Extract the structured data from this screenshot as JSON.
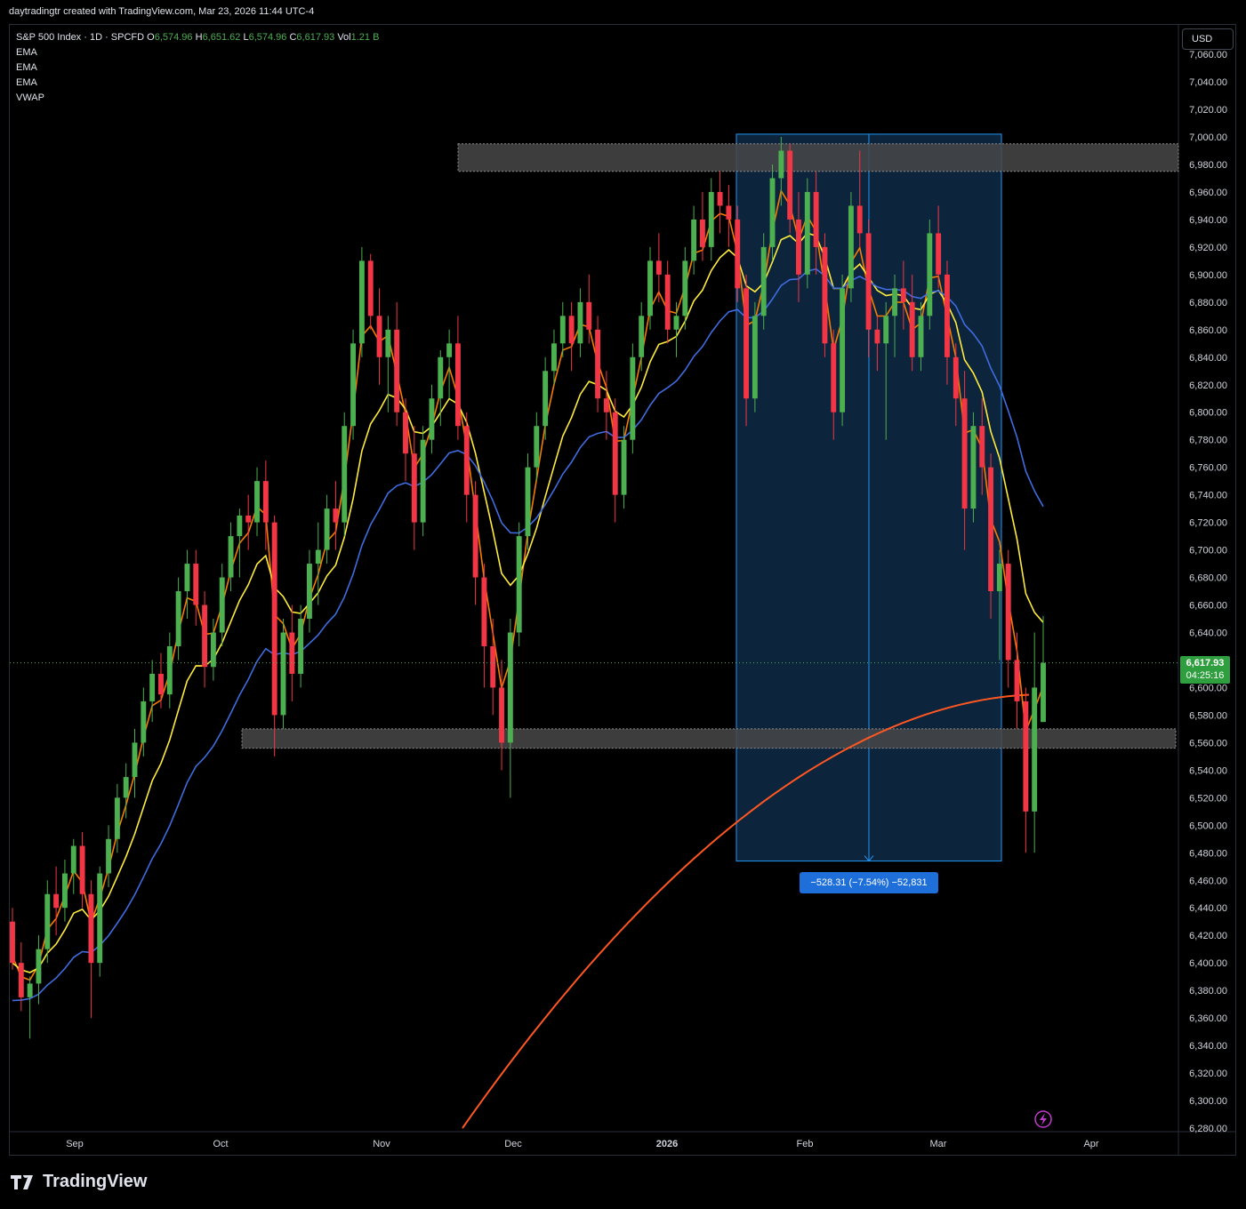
{
  "attribution": "daytradingtr created with TradingView.com, Mar 23, 2026 11:44 UTC-4",
  "legend": {
    "symbol": "S&P 500 Index · 1D · SPCFD",
    "o_label": "O",
    "o": "6,574.96",
    "h_label": "H",
    "h": "6,651.62",
    "l_label": "L",
    "l": "6,574.96",
    "c_label": "C",
    "c": "6,617.93",
    "vol_label": "Vol",
    "vol": "1.21 B",
    "indicators": [
      "EMA",
      "EMA",
      "EMA",
      "VWAP"
    ]
  },
  "currency_button": "USD",
  "last_price": {
    "value": "6,617.93",
    "countdown": "04:25:16"
  },
  "measure_label": "−528.31 (−7.54%) −52,831",
  "brand": "TradingView",
  "colors": {
    "up": "#4caf50",
    "down": "#f23645",
    "ema_fast": "#f57c00",
    "ema_mid": "#ffeb3b",
    "ema_slow": "#3f6ce0",
    "vwap": "#ff5722",
    "zone": "#484848",
    "measure_fill": "#0f2a48",
    "measure_line": "#2196f3"
  },
  "chart_data": {
    "type": "candlestick",
    "title": "S&P 500 Index · 1D · SPCFD",
    "ylim": [
      6280,
      7020
    ],
    "y_ticks": [
      "7,060.00",
      "7,040.00",
      "7,020.00",
      "7,000.00",
      "6,980.00",
      "6,960.00",
      "6,940.00",
      "6,920.00",
      "6,900.00",
      "6,880.00",
      "6,860.00",
      "6,840.00",
      "6,820.00",
      "6,800.00",
      "6,780.00",
      "6,760.00",
      "6,740.00",
      "6,720.00",
      "6,700.00",
      "6,680.00",
      "6,660.00",
      "6,640.00",
      "6,620.00",
      "6,600.00",
      "6,580.00",
      "6,560.00",
      "6,540.00",
      "6,520.00",
      "6,500.00",
      "6,480.00",
      "6,460.00",
      "6,440.00",
      "6,420.00",
      "6,400.00",
      "6,380.00",
      "6,360.00",
      "6,340.00",
      "6,320.00",
      "6,300.00",
      "6,280.00"
    ],
    "x_ticks": [
      {
        "label": "Sep",
        "date": "2025-09-02"
      },
      {
        "label": "Oct",
        "date": "2025-10-01"
      },
      {
        "label": "Nov",
        "date": "2025-11-03"
      },
      {
        "label": "Dec",
        "date": "2025-12-01"
      },
      {
        "label": "2026",
        "date": "2026-01-02"
      },
      {
        "label": "Feb",
        "date": "2026-02-02"
      },
      {
        "label": "Mar",
        "date": "2026-03-02"
      },
      {
        "label": "Apr",
        "date": "2026-04-01"
      }
    ],
    "candles": [
      [
        6430,
        6440,
        6395,
        6400
      ],
      [
        6400,
        6415,
        6365,
        6375
      ],
      [
        6375,
        6390,
        6345,
        6385
      ],
      [
        6385,
        6420,
        6370,
        6410
      ],
      [
        6410,
        6460,
        6400,
        6450
      ],
      [
        6450,
        6470,
        6420,
        6440
      ],
      [
        6440,
        6475,
        6430,
        6465
      ],
      [
        6465,
        6490,
        6450,
        6485
      ],
      [
        6485,
        6495,
        6440,
        6450
      ],
      [
        6450,
        6460,
        6360,
        6400
      ],
      [
        6400,
        6470,
        6390,
        6465
      ],
      [
        6465,
        6500,
        6455,
        6490
      ],
      [
        6490,
        6530,
        6480,
        6520
      ],
      [
        6520,
        6545,
        6505,
        6535
      ],
      [
        6535,
        6570,
        6520,
        6560
      ],
      [
        6560,
        6600,
        6550,
        6590
      ],
      [
        6590,
        6620,
        6575,
        6610
      ],
      [
        6610,
        6625,
        6585,
        6595
      ],
      [
        6595,
        6640,
        6585,
        6630
      ],
      [
        6630,
        6680,
        6620,
        6670
      ],
      [
        6670,
        6700,
        6650,
        6690
      ],
      [
        6690,
        6700,
        6645,
        6660
      ],
      [
        6660,
        6670,
        6600,
        6615
      ],
      [
        6615,
        6650,
        6605,
        6640
      ],
      [
        6640,
        6690,
        6630,
        6680
      ],
      [
        6680,
        6720,
        6670,
        6710
      ],
      [
        6710,
        6730,
        6680,
        6725
      ],
      [
        6725,
        6740,
        6700,
        6720
      ],
      [
        6720,
        6760,
        6710,
        6750
      ],
      [
        6750,
        6765,
        6700,
        6720
      ],
      [
        6720,
        6725,
        6550,
        6580
      ],
      [
        6580,
        6650,
        6570,
        6640
      ],
      [
        6640,
        6660,
        6590,
        6610
      ],
      [
        6610,
        6660,
        6600,
        6650
      ],
      [
        6650,
        6700,
        6640,
        6690
      ],
      [
        6690,
        6720,
        6660,
        6700
      ],
      [
        6700,
        6740,
        6690,
        6730
      ],
      [
        6730,
        6750,
        6700,
        6720
      ],
      [
        6720,
        6800,
        6710,
        6790
      ],
      [
        6790,
        6860,
        6780,
        6850
      ],
      [
        6850,
        6920,
        6840,
        6910
      ],
      [
        6910,
        6915,
        6860,
        6870
      ],
      [
        6870,
        6890,
        6820,
        6840
      ],
      [
        6840,
        6870,
        6800,
        6860
      ],
      [
        6860,
        6880,
        6790,
        6800
      ],
      [
        6800,
        6810,
        6750,
        6770
      ],
      [
        6770,
        6790,
        6700,
        6720
      ],
      [
        6720,
        6790,
        6710,
        6780
      ],
      [
        6780,
        6820,
        6770,
        6810
      ],
      [
        6810,
        6845,
        6790,
        6840
      ],
      [
        6840,
        6860,
        6810,
        6850
      ],
      [
        6850,
        6870,
        6780,
        6790
      ],
      [
        6790,
        6800,
        6720,
        6740
      ],
      [
        6740,
        6750,
        6660,
        6680
      ],
      [
        6680,
        6690,
        6600,
        6630
      ],
      [
        6630,
        6650,
        6580,
        6600
      ],
      [
        6600,
        6620,
        6540,
        6560
      ],
      [
        6560,
        6650,
        6520,
        6640
      ],
      [
        6640,
        6720,
        6630,
        6710
      ],
      [
        6710,
        6770,
        6700,
        6760
      ],
      [
        6760,
        6800,
        6750,
        6790
      ],
      [
        6790,
        6840,
        6780,
        6830
      ],
      [
        6830,
        6860,
        6820,
        6850
      ],
      [
        6850,
        6880,
        6840,
        6870
      ],
      [
        6870,
        6880,
        6830,
        6850
      ],
      [
        6850,
        6890,
        6840,
        6880
      ],
      [
        6880,
        6900,
        6850,
        6860
      ],
      [
        6860,
        6870,
        6800,
        6810
      ],
      [
        6810,
        6830,
        6780,
        6800
      ],
      [
        6800,
        6810,
        6720,
        6740
      ],
      [
        6740,
        6790,
        6730,
        6780
      ],
      [
        6780,
        6850,
        6770,
        6840
      ],
      [
        6840,
        6880,
        6830,
        6870
      ],
      [
        6870,
        6920,
        6860,
        6910
      ],
      [
        6910,
        6930,
        6880,
        6900
      ],
      [
        6900,
        6910,
        6850,
        6860
      ],
      [
        6860,
        6880,
        6840,
        6870
      ],
      [
        6870,
        6920,
        6860,
        6910
      ],
      [
        6910,
        6950,
        6900,
        6940
      ],
      [
        6940,
        6960,
        6910,
        6920
      ],
      [
        6920,
        6970,
        6910,
        6960
      ],
      [
        6960,
        6975,
        6930,
        6950
      ],
      [
        6950,
        6965,
        6920,
        6940
      ],
      [
        6940,
        6950,
        6880,
        6890
      ],
      [
        6890,
        6900,
        6790,
        6810
      ],
      [
        6810,
        6880,
        6800,
        6870
      ],
      [
        6870,
        6930,
        6860,
        6920
      ],
      [
        6920,
        6980,
        6910,
        6970
      ],
      [
        6970,
        7000,
        6950,
        6990
      ],
      [
        6990,
        6995,
        6930,
        6940
      ],
      [
        6940,
        6960,
        6880,
        6900
      ],
      [
        6900,
        6970,
        6890,
        6960
      ],
      [
        6960,
        6975,
        6900,
        6920
      ],
      [
        6920,
        6930,
        6840,
        6850
      ],
      [
        6850,
        6860,
        6780,
        6800
      ],
      [
        6800,
        6900,
        6790,
        6890
      ],
      [
        6890,
        6960,
        6880,
        6950
      ],
      [
        6950,
        6990,
        6920,
        6930
      ],
      [
        6930,
        6940,
        6840,
        6860
      ],
      [
        6860,
        6870,
        6830,
        6850
      ],
      [
        6850,
        6880,
        6780,
        6870
      ],
      [
        6870,
        6900,
        6840,
        6890
      ],
      [
        6890,
        6910,
        6860,
        6880
      ],
      [
        6880,
        6900,
        6830,
        6840
      ],
      [
        6840,
        6880,
        6830,
        6870
      ],
      [
        6870,
        6940,
        6860,
        6930
      ],
      [
        6930,
        6950,
        6890,
        6900
      ],
      [
        6900,
        6910,
        6820,
        6840
      ],
      [
        6840,
        6850,
        6790,
        6810
      ],
      [
        6810,
        6830,
        6700,
        6730
      ],
      [
        6730,
        6800,
        6720,
        6790
      ],
      [
        6790,
        6810,
        6740,
        6760
      ],
      [
        6760,
        6770,
        6650,
        6670
      ],
      [
        6670,
        6700,
        6620,
        6690
      ],
      [
        6690,
        6700,
        6600,
        6620
      ],
      [
        6620,
        6640,
        6570,
        6590
      ],
      [
        6590,
        6600,
        6480,
        6510
      ],
      [
        6510,
        6640,
        6480,
        6600
      ],
      [
        6575,
        6652,
        6575,
        6618
      ]
    ],
    "series": [
      {
        "name": "EMA",
        "color": "#f57c00",
        "values": []
      },
      {
        "name": "EMA",
        "color": "#ffeb3b",
        "values": []
      },
      {
        "name": "EMA",
        "color": "#3f6ce0",
        "values": []
      },
      {
        "name": "VWAP",
        "color": "#ff5722",
        "values": []
      }
    ],
    "zones": [
      {
        "from": 6975,
        "to": 6995,
        "start_index": 67,
        "end_index": 118
      },
      {
        "from": 6556,
        "to": 6570,
        "start_index": 36,
        "end_index": 118
      }
    ],
    "measure": {
      "high": 7002,
      "low": 6474,
      "change": "-528.31",
      "pct": "-7.54%"
    }
  }
}
